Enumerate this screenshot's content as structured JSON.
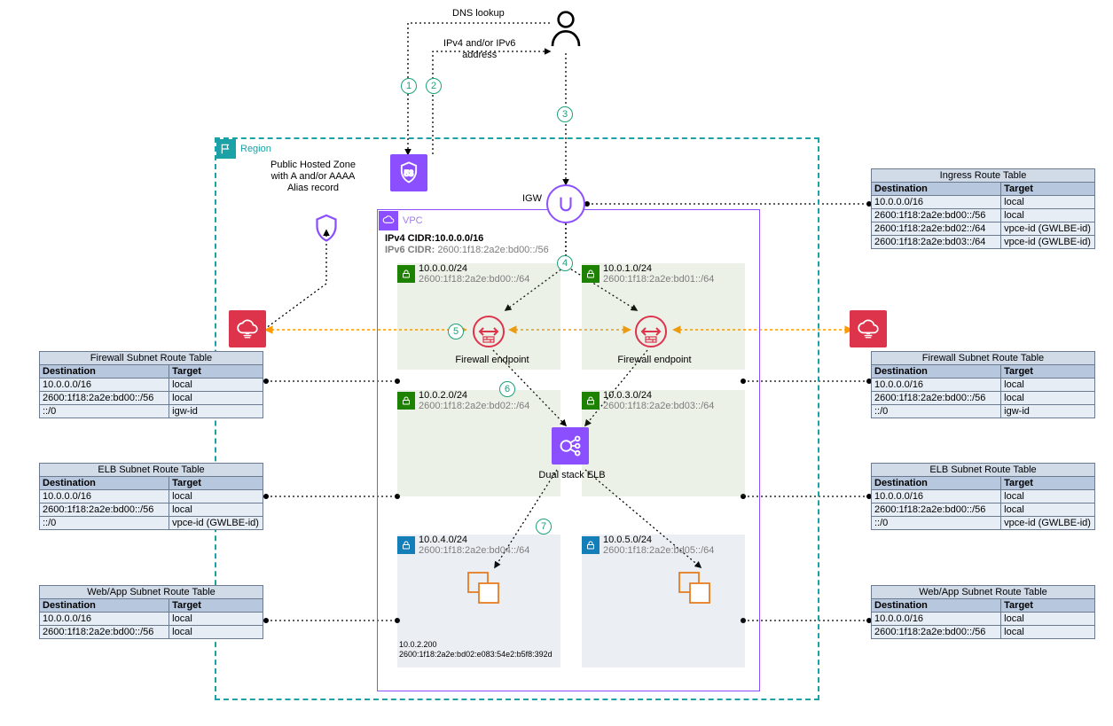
{
  "labels": {
    "dns_lookup": "DNS lookup",
    "ip_address": "IPv4 and/or IPv6\naddress",
    "hosted_zone": "Public Hosted Zone\nwith A and/or AAAA\nAlias record",
    "region": "Region",
    "vpc": "VPC",
    "igw": "IGW",
    "ipv4_cidr_label": "IPv4 CIDR:",
    "ipv4_cidr_value": "10.0.0.0/16",
    "ipv6_cidr_label": "IPv6 CIDR:",
    "ipv6_cidr_value": "2600:1f18:2a2e:bd00::/56",
    "firewall_endpoint_a": "Firewall endpoint",
    "firewall_endpoint_b": "Firewall endpoint",
    "dual_stack_elb": "Dual stack ELB",
    "ec2_ip1": "10.0.2.200",
    "ec2_ip2": "2600:1f18:2a2e:bd02:e083:54e2:b5f8:392d"
  },
  "subnets": {
    "fw_a": {
      "v4": "10.0.0.0/24",
      "v6": "2600:1f18:2a2e:bd00::/64"
    },
    "fw_b": {
      "v4": "10.0.1.0/24",
      "v6": "2600:1f18:2a2e:bd01::/64"
    },
    "elb_a": {
      "v4": "10.0.2.0/24",
      "v6": "2600:1f18:2a2e:bd02::/64"
    },
    "elb_b": {
      "v4": "10.0.3.0/24",
      "v6": "2600:1f18:2a2e:bd03::/64"
    },
    "app_a": {
      "v4": "10.0.4.0/24",
      "v6": "2600:1f18:2a2e:bd04::/64"
    },
    "app_b": {
      "v4": "10.0.5.0/24",
      "v6": "2600:1f18:2a2e:bd05::/64"
    }
  },
  "tables": {
    "ingress": {
      "title": "Ingress Route Table",
      "cols": [
        "Destination",
        "Target"
      ],
      "rows": [
        [
          "10.0.0.0/16",
          "local"
        ],
        [
          "2600:1f18:2a2e:bd00::/56",
          "local"
        ],
        [
          "2600:1f18:2a2e:bd02::/64",
          "vpce-id (GWLBE-id)"
        ],
        [
          "2600:1f18:2a2e:bd03::/64",
          "vpce-id (GWLBE-id)"
        ]
      ]
    },
    "fw_left": {
      "title": "Firewall Subnet Route Table",
      "cols": [
        "Destination",
        "Target"
      ],
      "rows": [
        [
          "10.0.0.0/16",
          "local"
        ],
        [
          "2600:1f18:2a2e:bd00::/56",
          "local"
        ],
        [
          "::/0",
          "igw-id"
        ]
      ]
    },
    "fw_right": {
      "title": "Firewall Subnet Route Table",
      "cols": [
        "Destination",
        "Target"
      ],
      "rows": [
        [
          "10.0.0.0/16",
          "local"
        ],
        [
          "2600:1f18:2a2e:bd00::/56",
          "local"
        ],
        [
          "::/0",
          "igw-id"
        ]
      ]
    },
    "elb_left": {
      "title": "ELB Subnet Route Table",
      "cols": [
        "Destination",
        "Target"
      ],
      "rows": [
        [
          "10.0.0.0/16",
          "local"
        ],
        [
          "2600:1f18:2a2e:bd00::/56",
          "local"
        ],
        [
          "::/0",
          "vpce-id (GWLBE-id)"
        ]
      ]
    },
    "elb_right": {
      "title": "ELB Subnet Route Table",
      "cols": [
        "Destination",
        "Target"
      ],
      "rows": [
        [
          "10.0.0.0/16",
          "local"
        ],
        [
          "2600:1f18:2a2e:bd00::/56",
          "local"
        ],
        [
          "::/0",
          "vpce-id (GWLBE-id)"
        ]
      ]
    },
    "app_left": {
      "title": "Web/App Subnet Route Table",
      "cols": [
        "Destination",
        "Target"
      ],
      "rows": [
        [
          "10.0.0.0/16",
          "local"
        ],
        [
          "2600:1f18:2a2e:bd00::/56",
          "local"
        ]
      ]
    },
    "app_right": {
      "title": "Web/App Subnet Route Table",
      "cols": [
        "Destination",
        "Target"
      ],
      "rows": [
        [
          "10.0.0.0/16",
          "local"
        ],
        [
          "2600:1f18:2a2e:bd00::/56",
          "local"
        ]
      ]
    }
  },
  "steps": [
    "1",
    "2",
    "3",
    "4",
    "5",
    "6",
    "7"
  ]
}
